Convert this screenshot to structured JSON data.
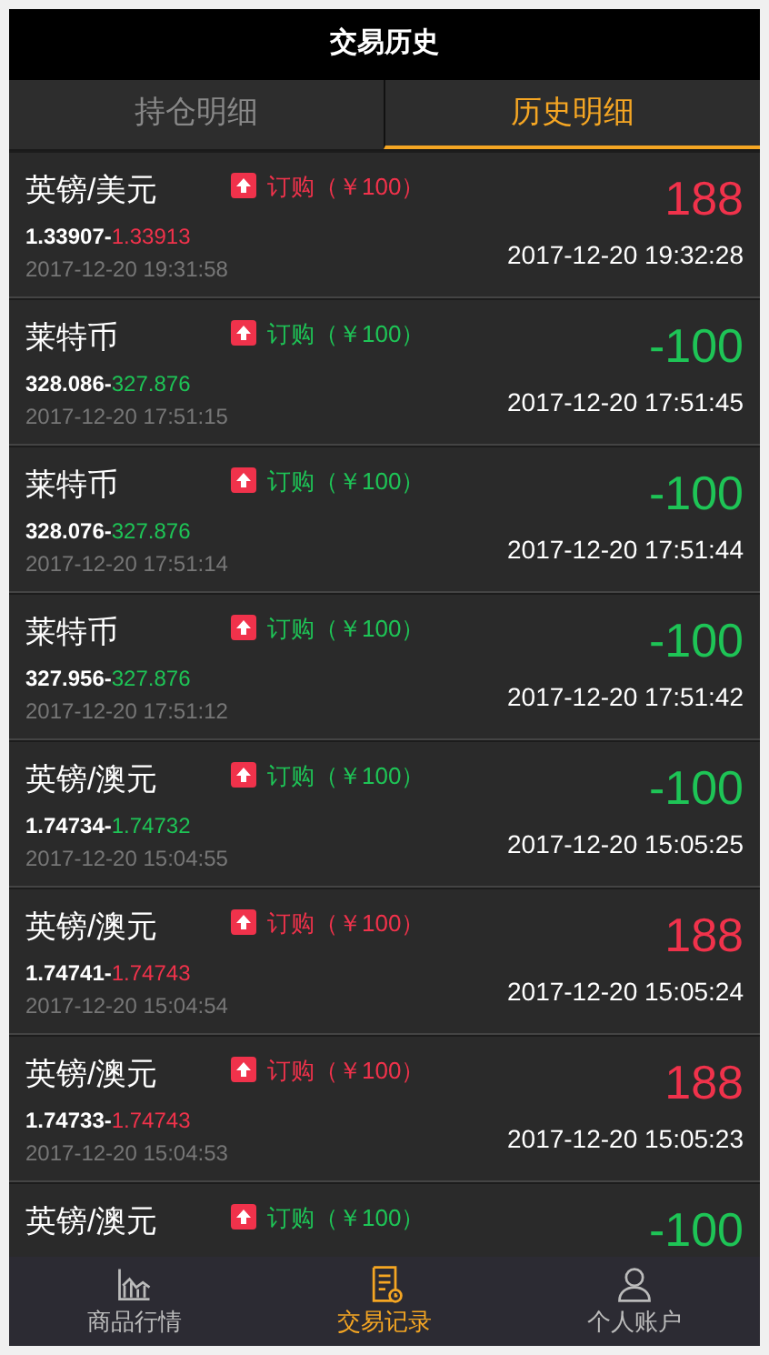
{
  "header": {
    "title": "交易历史"
  },
  "tabs": [
    {
      "label": "持仓明细",
      "selected": false
    },
    {
      "label": "历史明细",
      "selected": true
    }
  ],
  "trades": [
    {
      "name": "英镑/美元",
      "tag": "订购（￥100）",
      "color": "#f0324b",
      "open_price": "1.33907-",
      "close_price": "1.33913",
      "amount": "188",
      "open_time": "2017-12-20 19:31:58",
      "close_time": "2017-12-20 19:32:28"
    },
    {
      "name": "莱特币",
      "tag": "订购（￥100）",
      "color": "#1ec456",
      "open_price": "328.086-",
      "close_price": "327.876",
      "amount": "-100",
      "open_time": "2017-12-20 17:51:15",
      "close_time": "2017-12-20 17:51:45"
    },
    {
      "name": "莱特币",
      "tag": "订购（￥100）",
      "color": "#1ec456",
      "open_price": "328.076-",
      "close_price": "327.876",
      "amount": "-100",
      "open_time": "2017-12-20 17:51:14",
      "close_time": "2017-12-20 17:51:44"
    },
    {
      "name": "莱特币",
      "tag": "订购（￥100）",
      "color": "#1ec456",
      "open_price": "327.956-",
      "close_price": "327.876",
      "amount": "-100",
      "open_time": "2017-12-20 17:51:12",
      "close_time": "2017-12-20 17:51:42"
    },
    {
      "name": "英镑/澳元",
      "tag": "订购（￥100）",
      "color": "#1ec456",
      "open_price": "1.74734-",
      "close_price": "1.74732",
      "amount": "-100",
      "open_time": "2017-12-20 15:04:55",
      "close_time": "2017-12-20 15:05:25"
    },
    {
      "name": "英镑/澳元",
      "tag": "订购（￥100）",
      "color": "#f0324b",
      "open_price": "1.74741-",
      "close_price": "1.74743",
      "amount": "188",
      "open_time": "2017-12-20 15:04:54",
      "close_time": "2017-12-20 15:05:24"
    },
    {
      "name": "英镑/澳元",
      "tag": "订购（￥100）",
      "color": "#f0324b",
      "open_price": "1.74733-",
      "close_price": "1.74743",
      "amount": "188",
      "open_time": "2017-12-20 15:04:53",
      "close_time": "2017-12-20 15:05:23"
    },
    {
      "name": "英镑/澳元",
      "tag": "订购（￥100）",
      "color": "#1ec456",
      "amount": "-100"
    }
  ],
  "nav": [
    {
      "kind": "chart",
      "label": "商品行情",
      "selected": false
    },
    {
      "kind": "record",
      "label": "交易记录",
      "selected": true
    },
    {
      "kind": "person",
      "label": "个人账户",
      "selected": false
    }
  ]
}
